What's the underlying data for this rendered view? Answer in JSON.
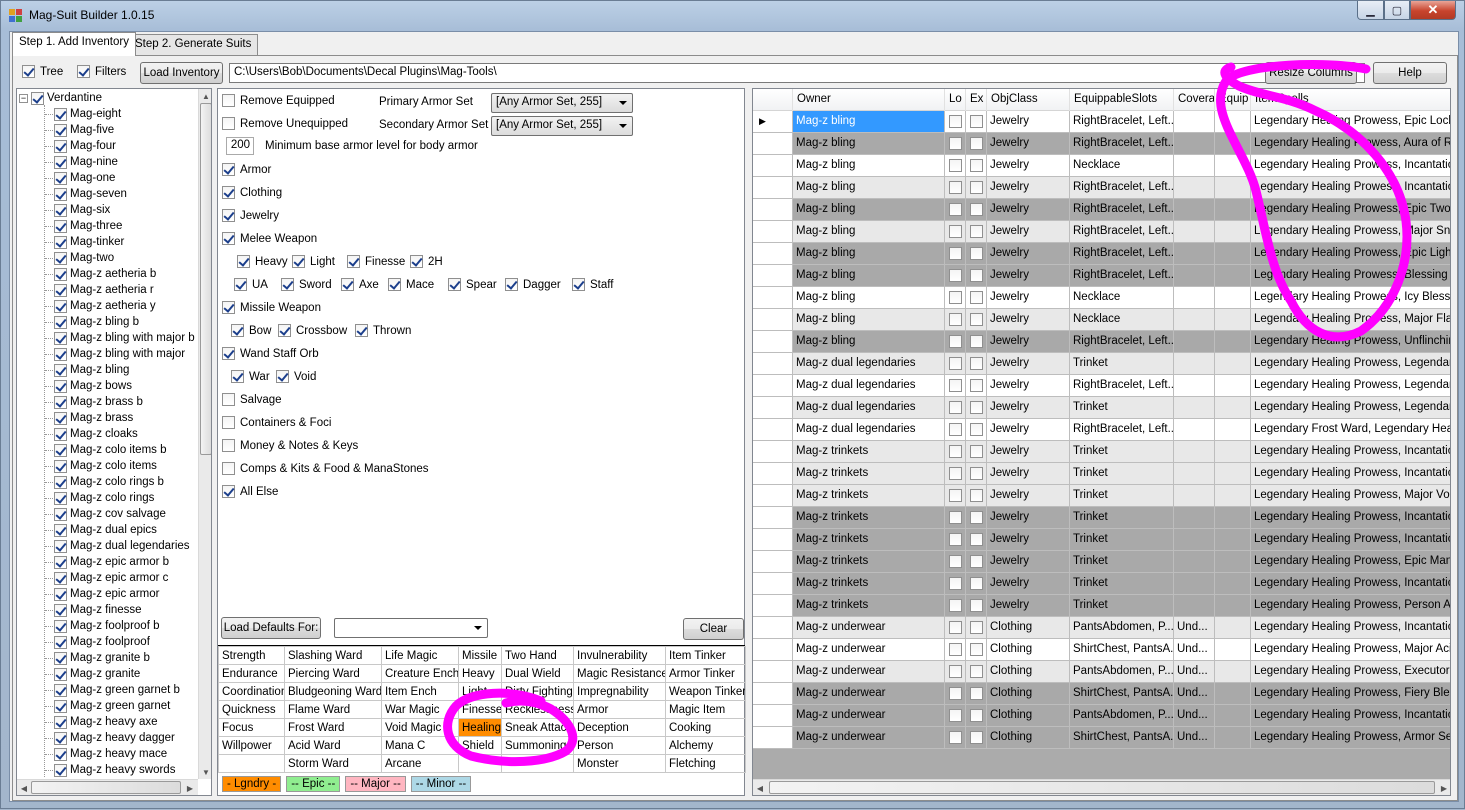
{
  "window": {
    "title": "Mag-Suit Builder 1.0.15"
  },
  "colors": {
    "magenta_mark": "#ff00ff",
    "legendary": "#ff8c00",
    "epic": "#90ee90",
    "major": "#ffb6c1",
    "minor": "#add8e6",
    "grid_dark": "#a9a9a9",
    "grid_light": "#e8e8e8",
    "grid_white": "#ffffff",
    "selected": "#3399ff"
  },
  "tabs": [
    {
      "label": "Step 1. Add Inventory",
      "active": true
    },
    {
      "label": "Step 2. Generate Suits",
      "active": false
    }
  ],
  "toolbar": {
    "tree_label": "Tree",
    "tree_checked": true,
    "filters_label": "Filters",
    "filters_checked": true,
    "load_inventory": "Load Inventory",
    "path": "C:\\Users\\Bob\\Documents\\Decal Plugins\\Mag-Tools\\",
    "resize_columns": "Resize Columns",
    "help": "Help"
  },
  "tree": {
    "root": "Verdantine",
    "items": [
      "Mag-eight",
      "Mag-five",
      "Mag-four",
      "Mag-nine",
      "Mag-one",
      "Mag-seven",
      "Mag-six",
      "Mag-three",
      "Mag-tinker",
      "Mag-two",
      "Mag-z aetheria b",
      "Mag-z aetheria r",
      "Mag-z aetheria y",
      "Mag-z bling b",
      "Mag-z bling with major b",
      "Mag-z bling with major",
      "Mag-z bling",
      "Mag-z bows",
      "Mag-z brass b",
      "Mag-z brass",
      "Mag-z cloaks",
      "Mag-z colo items b",
      "Mag-z colo items",
      "Mag-z colo rings b",
      "Mag-z colo rings",
      "Mag-z cov salvage",
      "Mag-z dual epics",
      "Mag-z dual legendaries",
      "Mag-z epic armor b",
      "Mag-z epic armor c",
      "Mag-z epic armor",
      "Mag-z finesse",
      "Mag-z foolproof b",
      "Mag-z foolproof",
      "Mag-z granite b",
      "Mag-z granite",
      "Mag-z green garnet b",
      "Mag-z green garnet",
      "Mag-z heavy axe",
      "Mag-z heavy dagger",
      "Mag-z heavy mace",
      "Mag-z heavy swords"
    ]
  },
  "filters": {
    "remove_equipped": "Remove Equipped",
    "remove_unequipped": "Remove Unequipped",
    "primary_armor_set_label": "Primary Armor Set",
    "primary_armor_set_value": "[Any Armor Set, 255]",
    "secondary_armor_set_label": "Secondary Armor Set",
    "secondary_armor_set_value": "[Any Armor Set, 255]",
    "min_armor_value": "200",
    "min_armor_label": "Minimum base armor level for body armor",
    "armor": "Armor",
    "clothing": "Clothing",
    "jewelry": "Jewelry",
    "melee_weapon": "Melee Weapon",
    "melee_sub1": [
      "Heavy",
      "Light",
      "Finesse",
      "2H"
    ],
    "melee_sub2": [
      "UA",
      "Sword",
      "Axe",
      "Mace",
      "Spear",
      "Dagger",
      "Staff"
    ],
    "missile_weapon": "Missile Weapon",
    "missile_sub": [
      "Bow",
      "Crossbow",
      "Thrown"
    ],
    "wand_staff_orb": "Wand Staff Orb",
    "wand_sub": [
      "War",
      "Void"
    ],
    "salvage": "Salvage",
    "containers": "Containers & Foci",
    "money": "Money & Notes & Keys",
    "comps": "Comps & Kits & Food & ManaStones",
    "all_else": "All Else",
    "load_defaults": "Load Defaults For:",
    "clear": "Clear"
  },
  "spell_grid": [
    [
      "Strength",
      "Slashing Ward",
      "Life Magic",
      "Missile",
      "Two Hand",
      "Invulnerability",
      "Item Tinker"
    ],
    [
      "Endurance",
      "Piercing Ward",
      "Creature Ench",
      "Heavy",
      "Dual Wield",
      "Magic Resistance",
      "Armor Tinker"
    ],
    [
      "Coordination",
      "Bludgeoning Ward",
      "Item Ench",
      "Light",
      "Dirty Fighting",
      "Impregnability",
      "Weapon Tinker"
    ],
    [
      "Quickness",
      "Flame Ward",
      "War Magic",
      "Finesse",
      "Recklessness",
      "Armor",
      "Magic Item"
    ],
    [
      "Focus",
      "Frost Ward",
      "Void Magic",
      "Healing",
      "Sneak Attack",
      "Deception",
      "Cooking"
    ],
    [
      "Willpower",
      "Acid Ward",
      "Mana C",
      "Shield",
      "Summoning",
      "Person",
      "Alchemy"
    ],
    [
      "",
      "Storm Ward",
      "Arcane",
      "",
      "",
      "Monster",
      "Fletching"
    ]
  ],
  "legend": [
    "- Lgndry -",
    "-- Epic --",
    "-- Major --",
    "-- Minor --"
  ],
  "grid": {
    "columns": [
      "Owner",
      "Lo",
      "Ex",
      "ObjClass",
      "EquippableSlots",
      "Covera",
      "Equip",
      "ItemSpells"
    ],
    "rows": [
      {
        "owner": "Mag-z bling",
        "cls": "Jewelry",
        "slots": "RightBracelet, Left...",
        "cov": "",
        "spells": "Legendary Healing Prowess, Epic Lockpick",
        "shade": "sel"
      },
      {
        "owner": "Mag-z bling",
        "cls": "Jewelry",
        "slots": "RightBracelet, Left...",
        "cov": "",
        "spells": "Legendary Healing Prowess, Aura of Resis",
        "shade": "dark"
      },
      {
        "owner": "Mag-z bling",
        "cls": "Jewelry",
        "slots": "Necklace",
        "cov": "",
        "spells": "Legendary Healing Prowess, Incantation of",
        "shade": "white"
      },
      {
        "owner": "Mag-z bling",
        "cls": "Jewelry",
        "slots": "RightBracelet, Left...",
        "cov": "",
        "spells": "Legendary Healing Prowess, Incantation of",
        "shade": "light"
      },
      {
        "owner": "Mag-z bling",
        "cls": "Jewelry",
        "slots": "RightBracelet, Left...",
        "cov": "",
        "spells": "Legendary Healing Prowess, Epic Two Ha",
        "shade": "dark"
      },
      {
        "owner": "Mag-z bling",
        "cls": "Jewelry",
        "slots": "RightBracelet, Left...",
        "cov": "",
        "spells": "Legendary Healing Prowess, Major Sneak",
        "shade": "light"
      },
      {
        "owner": "Mag-z bling",
        "cls": "Jewelry",
        "slots": "RightBracelet, Left...",
        "cov": "",
        "spells": "Legendary Healing Prowess, Epic Light W",
        "shade": "dark"
      },
      {
        "owner": "Mag-z bling",
        "cls": "Jewelry",
        "slots": "RightBracelet, Left...",
        "cov": "",
        "spells": "Legendary Healing Prowess, Blessing of th",
        "shade": "dark"
      },
      {
        "owner": "Mag-z bling",
        "cls": "Jewelry",
        "slots": "Necklace",
        "cov": "",
        "spells": "Legendary Healing Prowess, Icy Blessing",
        "shade": "white"
      },
      {
        "owner": "Mag-z bling",
        "cls": "Jewelry",
        "slots": "Necklace",
        "cov": "",
        "spells": "Legendary Healing Prowess, Major Flame W",
        "shade": "light"
      },
      {
        "owner": "Mag-z bling",
        "cls": "Jewelry",
        "slots": "RightBracelet, Left...",
        "cov": "",
        "spells": "Legendary Healing Prowess, Unflinching P",
        "shade": "dark"
      },
      {
        "owner": "Mag-z dual legendaries",
        "cls": "Jewelry",
        "slots": "Trinket",
        "cov": "",
        "spells": "Legendary Healing Prowess, Legendary He",
        "shade": "light"
      },
      {
        "owner": "Mag-z dual legendaries",
        "cls": "Jewelry",
        "slots": "RightBracelet, Left...",
        "cov": "",
        "spells": "Legendary Healing Prowess, Legendary He",
        "shade": "white"
      },
      {
        "owner": "Mag-z dual legendaries",
        "cls": "Jewelry",
        "slots": "Trinket",
        "cov": "",
        "spells": "Legendary Healing Prowess, Legendary Sn",
        "shade": "light"
      },
      {
        "owner": "Mag-z dual legendaries",
        "cls": "Jewelry",
        "slots": "RightBracelet, Left...",
        "cov": "",
        "spells": "Legendary Frost Ward, Legendary Healing",
        "shade": "white"
      },
      {
        "owner": "Mag-z trinkets",
        "cls": "Jewelry",
        "slots": "Trinket",
        "cov": "",
        "spells": "Legendary Healing Prowess, Incantation of",
        "shade": "light"
      },
      {
        "owner": "Mag-z trinkets",
        "cls": "Jewelry",
        "slots": "Trinket",
        "cov": "",
        "spells": "Legendary Healing Prowess, Incantation of",
        "shade": "light"
      },
      {
        "owner": "Mag-z trinkets",
        "cls": "Jewelry",
        "slots": "Trinket",
        "cov": "",
        "spells": "Legendary Healing Prowess, Major Void M",
        "shade": "light"
      },
      {
        "owner": "Mag-z trinkets",
        "cls": "Jewelry",
        "slots": "Trinket",
        "cov": "",
        "spells": "Legendary Healing Prowess, Incantation of",
        "shade": "dark"
      },
      {
        "owner": "Mag-z trinkets",
        "cls": "Jewelry",
        "slots": "Trinket",
        "cov": "",
        "spells": "Legendary Healing Prowess, Incantation of",
        "shade": "dark"
      },
      {
        "owner": "Mag-z trinkets",
        "cls": "Jewelry",
        "slots": "Trinket",
        "cov": "",
        "spells": "Legendary Healing Prowess, Epic Mana C",
        "shade": "dark"
      },
      {
        "owner": "Mag-z trinkets",
        "cls": "Jewelry",
        "slots": "Trinket",
        "cov": "",
        "spells": "Legendary Healing Prowess, Incantation of",
        "shade": "dark"
      },
      {
        "owner": "Mag-z trinkets",
        "cls": "Jewelry",
        "slots": "Trinket",
        "cov": "",
        "spells": "Legendary Healing Prowess, Person Attun",
        "shade": "dark"
      },
      {
        "owner": "Mag-z underwear",
        "cls": "Clothing",
        "slots": "PantsAbdomen, P...",
        "cov": "Und...",
        "spells": "Legendary Healing Prowess, Incantation of",
        "shade": "light"
      },
      {
        "owner": "Mag-z underwear",
        "cls": "Clothing",
        "slots": "ShirtChest, PantsA...",
        "cov": "Und...",
        "spells": "Legendary Healing Prowess, Major Acid W",
        "shade": "white"
      },
      {
        "owner": "Mag-z underwear",
        "cls": "Clothing",
        "slots": "PantsAbdomen, P...",
        "cov": "Und...",
        "spells": "Legendary Healing Prowess, Executor's Bl",
        "shade": "light"
      },
      {
        "owner": "Mag-z underwear",
        "cls": "Clothing",
        "slots": "ShirtChest, PantsA...",
        "cov": "Und...",
        "spells": "Legendary Healing Prowess, Fiery Blessing",
        "shade": "dark"
      },
      {
        "owner": "Mag-z underwear",
        "cls": "Clothing",
        "slots": "PantsAbdomen, P...",
        "cov": "Und...",
        "spells": "Legendary Healing Prowess, Incantation of",
        "shade": "dark"
      },
      {
        "owner": "Mag-z underwear",
        "cls": "Clothing",
        "slots": "ShirtChest, PantsA...",
        "cov": "Und...",
        "spells": "Legendary Healing Prowess, Armor Self VI",
        "shade": "dark"
      }
    ]
  }
}
